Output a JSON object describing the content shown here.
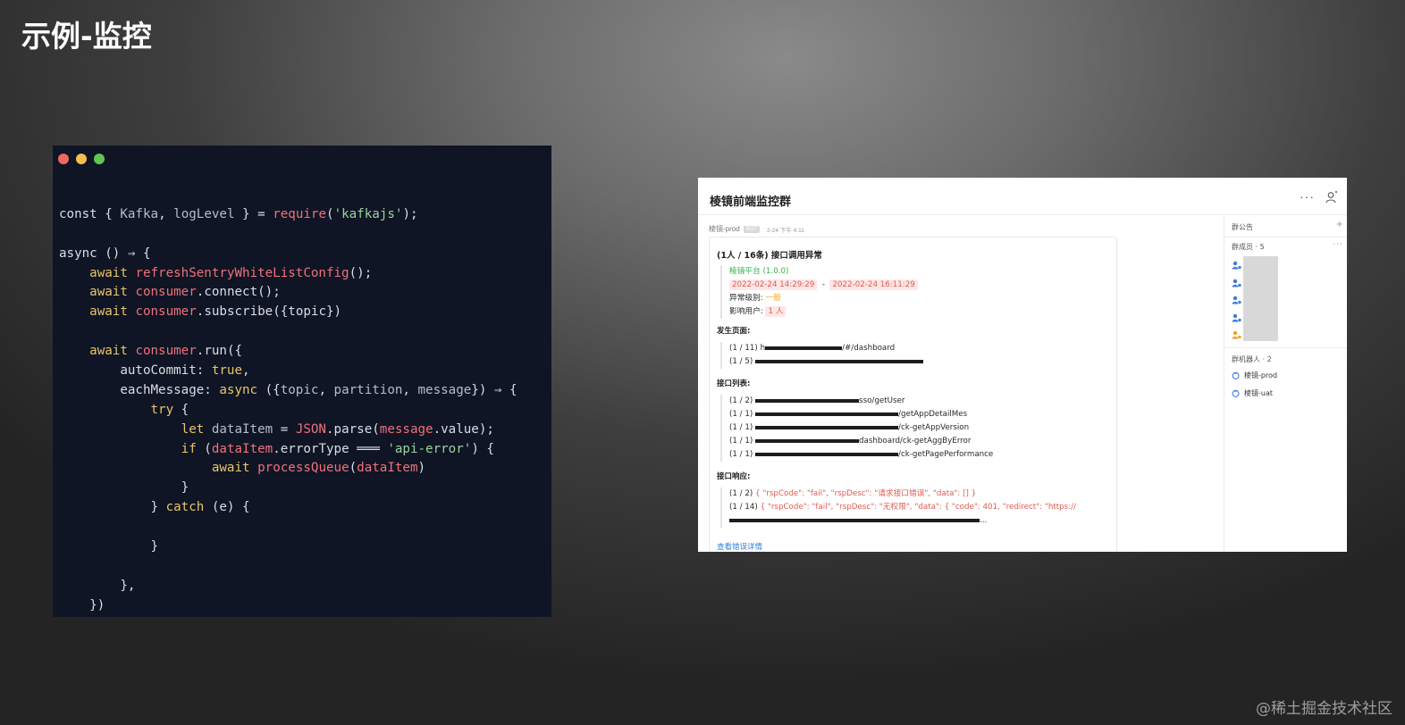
{
  "slide": {
    "title": "示例-监控",
    "watermark": "@稀土掘金技术社区"
  },
  "code_window": {
    "dot_colors": [
      "#ed6a5e",
      "#f4bf4f",
      "#61c454"
    ],
    "background": "#0f1524",
    "lines": [
      [],
      [
        {
          "t": "const { ",
          "c": "plain"
        },
        {
          "t": "Kafka",
          "c": "var"
        },
        {
          "t": ", ",
          "c": "plain"
        },
        {
          "t": "logLevel",
          "c": "var"
        },
        {
          "t": " } = ",
          "c": "plain"
        },
        {
          "t": "require",
          "c": "fn"
        },
        {
          "t": "(",
          "c": "plain"
        },
        {
          "t": "'kafkajs'",
          "c": "str"
        },
        {
          "t": ");",
          "c": "plain"
        }
      ],
      [],
      [
        {
          "t": "async",
          "c": "plain"
        },
        {
          "t": " () ⇒ {",
          "c": "plain"
        }
      ],
      [
        {
          "t": "    ",
          "c": "plain"
        },
        {
          "t": "await",
          "c": "kw"
        },
        {
          "t": " ",
          "c": "plain"
        },
        {
          "t": "refreshSentryWhiteListConfig",
          "c": "fn"
        },
        {
          "t": "();",
          "c": "plain"
        }
      ],
      [
        {
          "t": "    ",
          "c": "plain"
        },
        {
          "t": "await",
          "c": "kw"
        },
        {
          "t": " ",
          "c": "plain"
        },
        {
          "t": "consumer",
          "c": "fn"
        },
        {
          "t": ".connect();",
          "c": "plain"
        }
      ],
      [
        {
          "t": "    ",
          "c": "plain"
        },
        {
          "t": "await",
          "c": "kw"
        },
        {
          "t": " ",
          "c": "plain"
        },
        {
          "t": "consumer",
          "c": "fn"
        },
        {
          "t": ".subscribe({topic})",
          "c": "plain"
        }
      ],
      [],
      [
        {
          "t": "    ",
          "c": "plain"
        },
        {
          "t": "await",
          "c": "kw"
        },
        {
          "t": " ",
          "c": "plain"
        },
        {
          "t": "consumer",
          "c": "fn"
        },
        {
          "t": ".run({",
          "c": "plain"
        }
      ],
      [
        {
          "t": "        autoCommit: ",
          "c": "plain"
        },
        {
          "t": "true",
          "c": "bool"
        },
        {
          "t": ",",
          "c": "plain"
        }
      ],
      [
        {
          "t": "        eachMessage: ",
          "c": "plain"
        },
        {
          "t": "async",
          "c": "kw"
        },
        {
          "t": " ({",
          "c": "plain"
        },
        {
          "t": "topic",
          "c": "var"
        },
        {
          "t": ", ",
          "c": "plain"
        },
        {
          "t": "partition",
          "c": "var"
        },
        {
          "t": ", ",
          "c": "plain"
        },
        {
          "t": "message",
          "c": "var"
        },
        {
          "t": "}) ⇒ {",
          "c": "plain"
        }
      ],
      [
        {
          "t": "            ",
          "c": "plain"
        },
        {
          "t": "try",
          "c": "kw"
        },
        {
          "t": " {",
          "c": "plain"
        }
      ],
      [
        {
          "t": "                ",
          "c": "plain"
        },
        {
          "t": "let",
          "c": "kw"
        },
        {
          "t": " ",
          "c": "plain"
        },
        {
          "t": "dataItem",
          "c": "var"
        },
        {
          "t": " = ",
          "c": "plain"
        },
        {
          "t": "JSON",
          "c": "fn"
        },
        {
          "t": ".parse(",
          "c": "plain"
        },
        {
          "t": "message",
          "c": "fn"
        },
        {
          "t": ".value);",
          "c": "plain"
        }
      ],
      [
        {
          "t": "                ",
          "c": "plain"
        },
        {
          "t": "if",
          "c": "kw"
        },
        {
          "t": " (",
          "c": "plain"
        },
        {
          "t": "dataItem",
          "c": "fn"
        },
        {
          "t": ".errorType ",
          "c": "plain"
        },
        {
          "t": "═══",
          "c": "plain"
        },
        {
          "t": " ",
          "c": "plain"
        },
        {
          "t": "'api-error'",
          "c": "str"
        },
        {
          "t": ") {",
          "c": "plain"
        }
      ],
      [
        {
          "t": "                    ",
          "c": "plain"
        },
        {
          "t": "await",
          "c": "kw"
        },
        {
          "t": " ",
          "c": "plain"
        },
        {
          "t": "processQueue",
          "c": "fn"
        },
        {
          "t": "(",
          "c": "plain"
        },
        {
          "t": "dataItem",
          "c": "fn"
        },
        {
          "t": ")",
          "c": "plain"
        }
      ],
      [
        {
          "t": "                }",
          "c": "plain"
        }
      ],
      [
        {
          "t": "            } ",
          "c": "plain"
        },
        {
          "t": "catch",
          "c": "kw"
        },
        {
          "t": " (e) {",
          "c": "plain"
        }
      ],
      [],
      [
        {
          "t": "            }",
          "c": "plain"
        }
      ],
      [],
      [
        {
          "t": "        },",
          "c": "plain"
        }
      ],
      [
        {
          "t": "    })",
          "c": "plain"
        }
      ],
      [
        {
          "t": "}",
          "c": "plain"
        }
      ]
    ]
  },
  "chat": {
    "title": "棱镜前端监控群",
    "more_icon": "···",
    "sender": {
      "name": "棱镜-prod",
      "badge": "BOT",
      "time": "2-24 下午 4:11"
    },
    "card": {
      "title": "(1人 / 16条) 接口调用异常",
      "platform": "棱镜平台 (1.0.0)",
      "time_start": "2022-02-24 14:29:29",
      "time_sep": "-",
      "time_end": "2022-02-24 16:11:29",
      "level_label": "异常级别:",
      "level_value": "一般",
      "users_label": "影响用户:",
      "users_value": "1 人",
      "pages_title": "发生页面:",
      "pages": [
        {
          "count": "(1 / 11)",
          "prefix": "h",
          "path": "/#/dashboard",
          "strike_w": 86
        },
        {
          "count": "(1 / 5)",
          "prefix": "",
          "path": "",
          "strike_w": 188
        }
      ],
      "apis_title": "接口列表:",
      "apis": [
        {
          "count": "(1 / 2)",
          "path": "sso/getUser",
          "strike_w": 116
        },
        {
          "count": "(1 / 1)",
          "path": "/getAppDetailMes",
          "strike_w": 160
        },
        {
          "count": "(1 / 1)",
          "path": "/ck-getAppVersion",
          "strike_w": 160
        },
        {
          "count": "(1 / 1)",
          "path": "dashboard/ck-getAggByError",
          "strike_w": 116
        },
        {
          "count": "(1 / 1)",
          "path": "/ck-getPagePerformance",
          "strike_w": 160
        }
      ],
      "resp_title": "接口响应:",
      "responses": [
        {
          "count": "(1 / 2)",
          "text": "{ \"rspCode\": \"fail\", \"rspDesc\": \"请求接口错误\", \"data\": [] }"
        },
        {
          "count": "(1 / 14)",
          "text": "{ \"rspCode\": \"fail\", \"rspDesc\": \"无权限\", \"data\": {   \"code\": 401,   \"redirect\": \"https://"
        }
      ],
      "resp_tail": "...",
      "link": "查看错误详情"
    },
    "side": {
      "notice_label": "群公告",
      "notice_plus": "+",
      "members_label": "群成员 · 5",
      "members_more": "···",
      "bots_label": "群机器人 · 2",
      "bots": [
        "棱镜-prod",
        "棱镜-uat"
      ],
      "member_icon_colors": [
        "#3d7be0",
        "#3d7be0",
        "#3d7be0",
        "#3d7be0",
        "#f0a020"
      ]
    }
  }
}
